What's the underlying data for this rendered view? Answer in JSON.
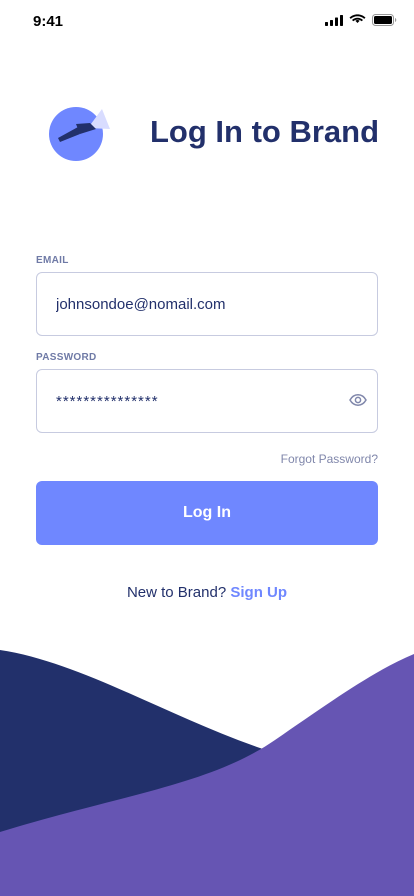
{
  "status_bar": {
    "time": "9:41",
    "icons": [
      "signal-icon",
      "wifi-icon",
      "battery-icon"
    ]
  },
  "header": {
    "title": "Log In to Brand",
    "logo_icon": "flashlight-icon"
  },
  "form": {
    "email": {
      "label": "EMAIL",
      "value": "johnsondoe@nomail.com"
    },
    "password": {
      "label": "PASSWORD",
      "value": "***************",
      "toggle_icon": "eye-icon"
    },
    "forgot_password": "Forgot Password?",
    "submit_label": "Log In"
  },
  "footer": {
    "prompt": "New to Brand?",
    "signup_label": "Sign Up"
  },
  "colors": {
    "primary": "#6f87ff",
    "navy": "#22306b",
    "purple": "#6655b3",
    "muted": "#8087ab",
    "border": "#c7cbe0"
  }
}
